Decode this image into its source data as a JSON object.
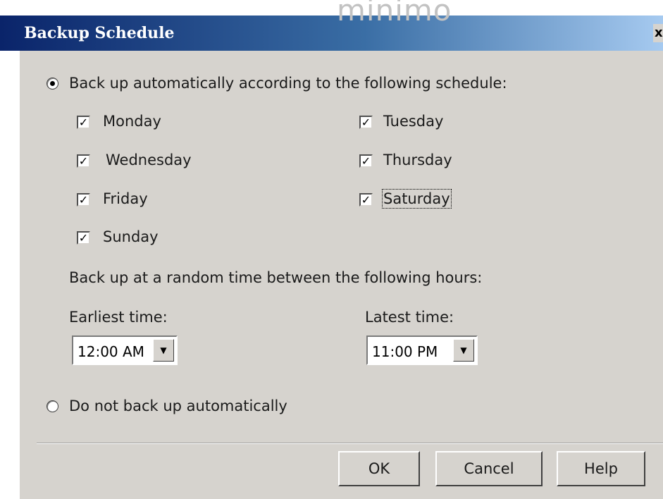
{
  "watermark": "minimo",
  "window": {
    "title": "Backup Schedule",
    "close_label": "x"
  },
  "auto_option": {
    "label": "Back up automatically according to the following schedule:",
    "selected": true
  },
  "days": {
    "monday": "Monday",
    "tuesday": "Tuesday",
    "wednesday": "Wednesday",
    "thursday": "Thursday",
    "friday": "Friday",
    "saturday": "Saturday",
    "sunday": "Sunday",
    "check_mark": "✓"
  },
  "random_time_label": "Back up at a random time between the following hours:",
  "earliest": {
    "label": "Earliest time:",
    "value": "12:00 AM"
  },
  "latest": {
    "label": "Latest time:",
    "value": "11:00 PM"
  },
  "manual_option": {
    "label": "Do not back up automatically",
    "selected": false
  },
  "buttons": {
    "ok": "OK",
    "cancel": "Cancel",
    "help": "Help"
  }
}
